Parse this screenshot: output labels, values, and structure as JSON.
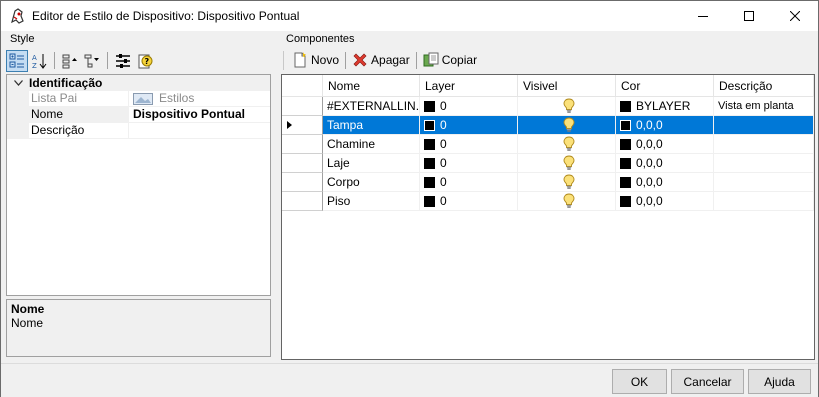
{
  "window": {
    "title": "Editor de Estilo de Dispositivo: Dispositivo Pontual"
  },
  "left": {
    "group_label": "Style",
    "category": "Identificação",
    "props": [
      {
        "name": "Lista Pai",
        "value": "Estilos"
      },
      {
        "name": "Nome",
        "value": "Dispositivo Pontual"
      },
      {
        "name": "Descrição",
        "value": ""
      }
    ],
    "help_title": "Nome",
    "help_text": "Nome"
  },
  "right": {
    "group_label": "Componentes",
    "toolbar": {
      "new": "Novo",
      "delete": "Apagar",
      "copy": "Copiar"
    },
    "columns": [
      "Nome",
      "Layer",
      "Visivel",
      "Cor",
      "Descrição"
    ],
    "rows": [
      {
        "nome": "#EXTERNALLIN...",
        "layer": "0",
        "cor": "BYLAYER",
        "descricao": "Vista em planta"
      },
      {
        "nome": "Tampa",
        "layer": "0",
        "cor": "0,0,0",
        "descricao": ""
      },
      {
        "nome": "Chamine",
        "layer": "0",
        "cor": "0,0,0",
        "descricao": ""
      },
      {
        "nome": "Laje",
        "layer": "0",
        "cor": "0,0,0",
        "descricao": ""
      },
      {
        "nome": "Corpo",
        "layer": "0",
        "cor": "0,0,0",
        "descricao": ""
      },
      {
        "nome": "Piso",
        "layer": "0",
        "cor": "0,0,0",
        "descricao": ""
      }
    ]
  },
  "buttons": {
    "ok": "OK",
    "cancel": "Cancelar",
    "help": "Ajuda"
  }
}
